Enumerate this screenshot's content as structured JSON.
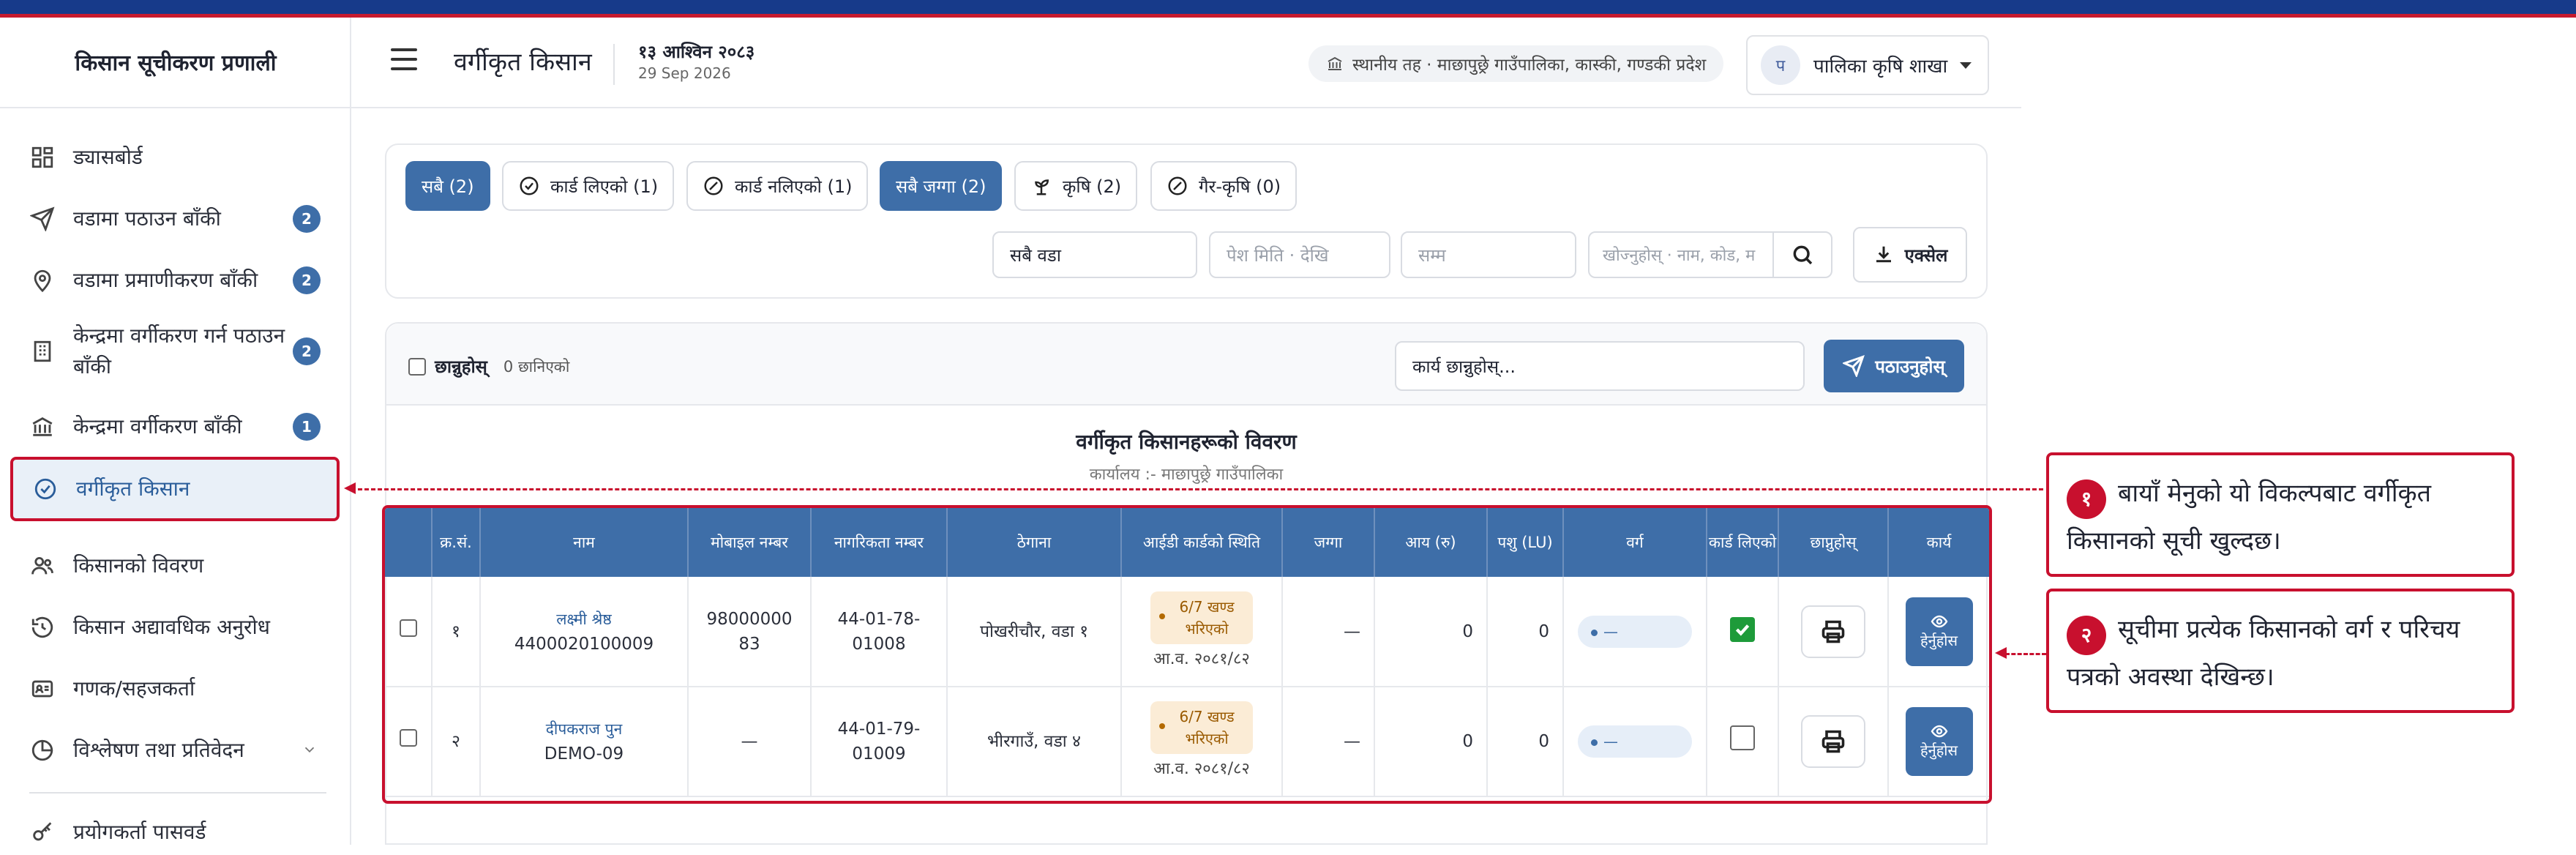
{
  "sidebar": {
    "app_title": "किसान सूचीकरण प्रणाली",
    "items": [
      {
        "label": "ड्यासबोर्ड",
        "icon": "dashboard-icon",
        "badge": ""
      },
      {
        "label": "वडामा पठाउन बाँकी",
        "icon": "send-icon",
        "badge": "2"
      },
      {
        "label": "वडामा प्रमाणीकरण बाँकी",
        "icon": "location-pin-icon",
        "badge": "2"
      },
      {
        "label": "केन्द्रमा वर्गीकरण गर्न पठाउन बाँकी",
        "icon": "building-icon",
        "badge": "2"
      },
      {
        "label": "केन्द्रमा वर्गीकरण बाँकी",
        "icon": "bank-icon",
        "badge": "1"
      },
      {
        "label": "वर्गीकृत किसान",
        "icon": "check-circle-icon",
        "badge": ""
      },
      {
        "label": "किसानको विवरण",
        "icon": "users-icon",
        "badge": ""
      },
      {
        "label": "किसान अद्यावधिक अनुरोध",
        "icon": "history-icon",
        "badge": ""
      },
      {
        "label": "गणक/सहजकर्ता",
        "icon": "id-card-icon",
        "badge": ""
      },
      {
        "label": "विश्लेषण तथा प्रतिवेदन",
        "icon": "pie-chart-icon",
        "badge": ""
      },
      {
        "label": "प्रयोगकर्ता पासवर्ड",
        "icon": "key-icon",
        "badge": ""
      }
    ]
  },
  "header": {
    "page_title": "वर्गीकृत किसान",
    "date_np": "१३ आश्विन २०८३",
    "date_en": "29 Sep 2026",
    "location": "स्थानीय तह · माछापुछ्रे गाउँपालिका, कास्की, गण्डकी प्रदेश",
    "avatar_letter": "प",
    "user_name": "पालिका कृषि शाखा"
  },
  "filters": {
    "chips": [
      "सबै (2)",
      "कार्ड लिएको (1)",
      "कार्ड नलिएको (1)",
      "सबै जग्गा (2)",
      "कृषि (2)",
      "गैर-कृषि (0)"
    ],
    "ward_select": "सबै वडा",
    "date_placeholder": "पेश मिति · देखि",
    "to_placeholder": "सम्म",
    "search_placeholder": "खोज्नुहोस् · नाम, कोड, म",
    "excel_label": "एक्सेल"
  },
  "action_bar": {
    "select_label": "छान्नुहोस्",
    "selected_count": "0 छानिएको",
    "task_placeholder": "कार्य छान्नुहोस्...",
    "send_label": "पठाउनुहोस्"
  },
  "table": {
    "title": "वर्गीकृत किसानहरूको विवरण",
    "subtitle": "कार्यालय :- माछापुछ्रे गाउँपालिका",
    "headers": [
      "",
      "क्र.सं.",
      "नाम",
      "मोबाइल नम्बर",
      "नागरिकता नम्बर",
      "ठेगाना",
      "आईडी कार्डको स्थिति",
      "जग्गा",
      "आय (रु)",
      "पशु (LU)",
      "वर्ग",
      "कार्ड लिएको",
      "छाप्नुहोस्",
      "कार्य"
    ],
    "rows": [
      {
        "sn": "१",
        "name": "लक्ष्मी श्रेष्ठ",
        "code": "4400020100009",
        "mobile": "9800000083",
        "citizenship": "44-01-78-01008",
        "address": "पोखरीचौर, वडा १",
        "status": "6/7 खण्ड भरिएको",
        "status_date": "आ.व. २०८१/८२",
        "land": "—",
        "income": "0",
        "livestock": "0",
        "category": "—",
        "card_taken": true,
        "view_label": "हेर्नुहोस"
      },
      {
        "sn": "२",
        "name": "दीपकराज पुन",
        "code": "DEMO-09",
        "mobile": "—",
        "citizenship": "44-01-79-01009",
        "address": "भीरगाउँ, वडा ४",
        "status": "6/7 खण्ड भरिएको",
        "status_date": "आ.व. २०८१/८२",
        "land": "—",
        "income": "0",
        "livestock": "0",
        "category": "—",
        "card_taken": false,
        "view_label": "हेर्नुहोस"
      }
    ]
  },
  "annotations": [
    {
      "num": "१",
      "text": "बायाँ मेनुको यो विकल्पबाट वर्गीकृत किसानको सूची खुल्दछ।"
    },
    {
      "num": "२",
      "text": "सूचीमा प्रत्येक किसानको वर्ग र परिचय पत्रको अवस्था देखिन्छ।"
    }
  ],
  "colors": {
    "accent": "#3e6ea8",
    "annotation": "#c8102e",
    "top_bar": "#173a8a"
  }
}
